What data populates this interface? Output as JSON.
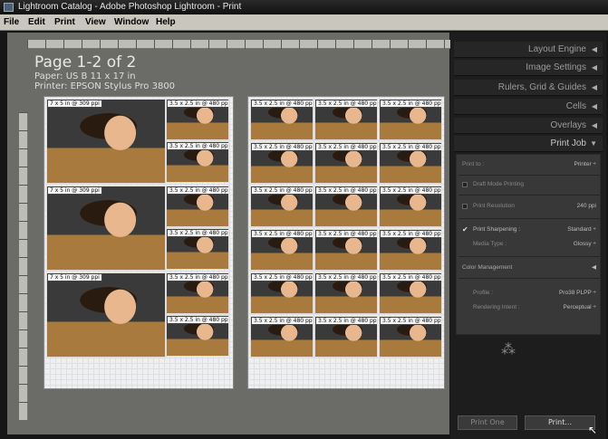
{
  "window": {
    "title": "Lightroom Catalog - Adobe Photoshop Lightroom - Print"
  },
  "menu": [
    "File",
    "Edit",
    "Print",
    "View",
    "Window",
    "Help"
  ],
  "info": {
    "title": "Page 1-2 of 2",
    "paper": "Paper:  US B 11 x 17 in",
    "printer": "Printer:  EPSON Stylus Pro 3800"
  },
  "cells": {
    "big": "7 x 5 in @ 309 ppi",
    "small": "3.5 x 2.5 in @ 480 ppi +"
  },
  "panels": {
    "layout_engine": "Layout Engine",
    "image_settings": "Image Settings",
    "rulers": "Rulers, Grid & Guides",
    "cells": "Cells",
    "overlays": "Overlays",
    "print_job": "Print Job"
  },
  "print_job": {
    "print_to_label": "Print to :",
    "print_to_value": "Printer ÷",
    "draft_mode": "Draft Mode Printing",
    "resolution_label": "Print Resolution",
    "resolution_value": "240",
    "resolution_unit": "ppi",
    "sharpening_label": "Print Sharpening :",
    "sharpening_value": "Standard ÷",
    "media_label": "Media Type :",
    "media_value": "Glossy ÷",
    "color_mgmt": "Color Management",
    "profile_label": "Profile :",
    "profile_value": "Pro38 PLPP ÷",
    "intent_label": "Rendering Intent :",
    "intent_value": "Perceptual ÷"
  },
  "buttons": {
    "print_one": "Print One",
    "print": "Print..."
  }
}
